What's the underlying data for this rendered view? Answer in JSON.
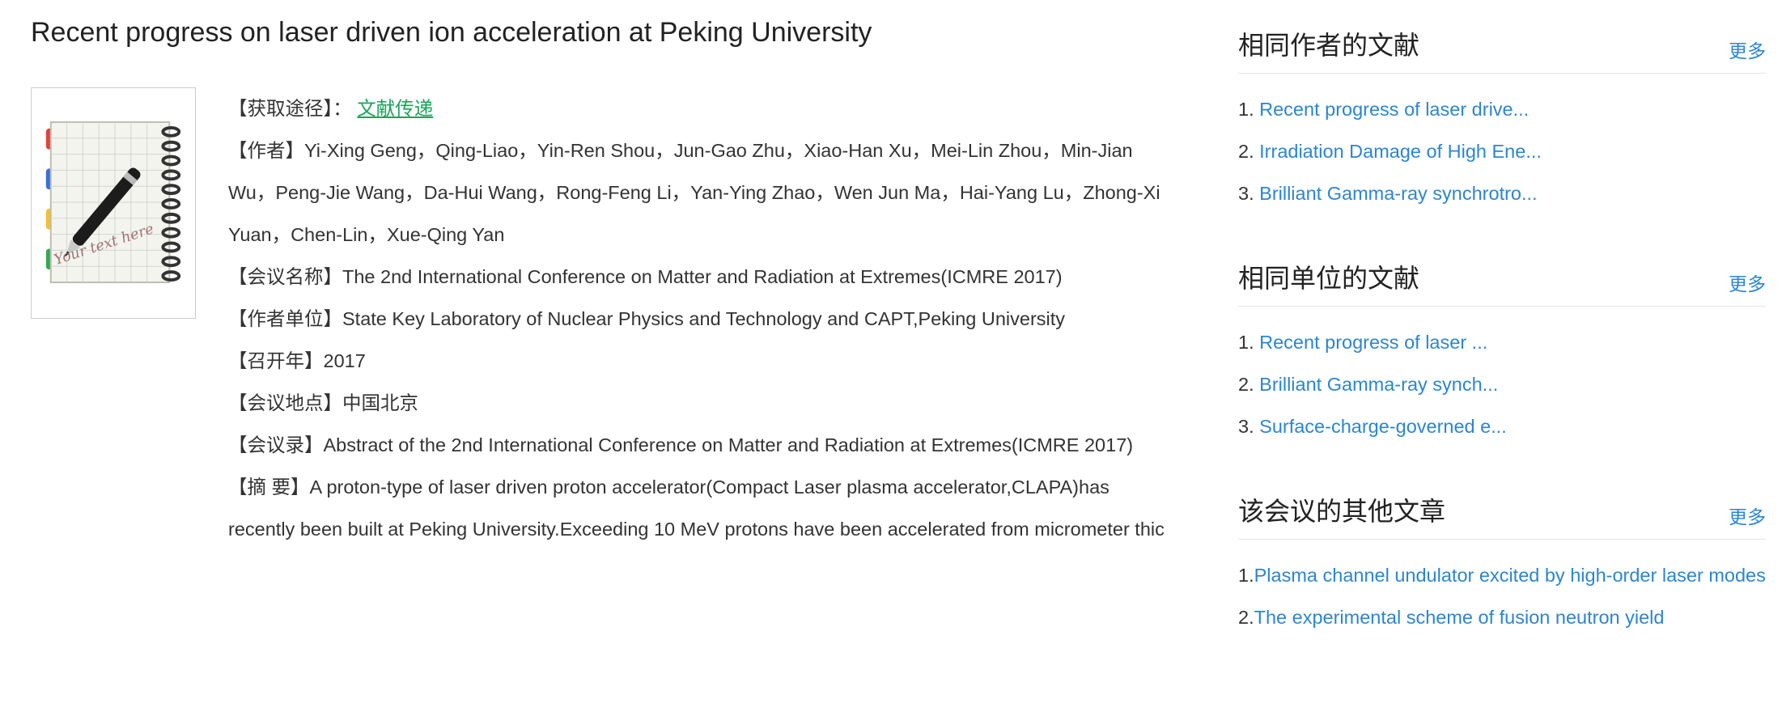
{
  "title": "Recent progress on laser driven ion acceleration at Peking University",
  "meta": {
    "access_label": "【获取途径】：",
    "access_link": "文献传递",
    "authors_label": "【作者】",
    "authors": "Yi-Xing Geng，Qing-Liao，Yin-Ren Shou，Jun-Gao Zhu，Xiao-Han Xu，Mei-Lin Zhou，Min-Jian Wu，Peng-Jie Wang，Da-Hui Wang，Rong-Feng Li，Yan-Ying Zhao，Wen Jun Ma，Hai-Yang Lu，Zhong-Xi Yuan，Chen-Lin，Xue-Qing Yan",
    "conference_label": "【会议名称】",
    "conference": "The 2nd International Conference on Matter and Radiation at Extremes(ICMRE 2017)",
    "affiliation_label": "【作者单位】",
    "affiliation": "State Key Laboratory of Nuclear Physics and Technology and CAPT,Peking University",
    "year_label": "【召开年】",
    "year": "2017",
    "location_label": "【会议地点】",
    "location": "中国北京",
    "proceedings_label": "【会议录】",
    "proceedings": "Abstract of the 2nd International Conference on Matter and Radiation at Extremes(ICMRE 2017)",
    "abstract_label": "【摘 要】",
    "abstract": "A proton-type of laser driven proton accelerator(Compact Laser plasma accelerator,CLAPA)has recently been built at Peking University.Exceeding 10 MeV protons have been accelerated from micrometer thic"
  },
  "thumbnail": {
    "caption": "Your text here"
  },
  "sidebar": {
    "more_label": "更多",
    "same_author": {
      "title": "相同作者的文献",
      "items": [
        {
          "num": "1.",
          "text": "Recent progress of laser drive..."
        },
        {
          "num": "2.",
          "text": "Irradiation Damage of High Ene..."
        },
        {
          "num": "3.",
          "text": "Brilliant Gamma-ray synchrotro..."
        }
      ]
    },
    "same_unit": {
      "title": "相同单位的文献",
      "items": [
        {
          "num": "1.",
          "text": "Recent progress of laser ..."
        },
        {
          "num": "2.",
          "text": "Brilliant Gamma-ray synch..."
        },
        {
          "num": "3.",
          "text": "Surface-charge-governed e..."
        }
      ]
    },
    "conference_other": {
      "title": "该会议的其他文章",
      "items": [
        {
          "num": "1.",
          "text": "Plasma channel undulator excited by high-order laser modes"
        },
        {
          "num": "2.",
          "text": "The experimental scheme of fusion neutron yield"
        }
      ]
    }
  },
  "colors": {
    "link": "#2b86d1",
    "green_link": "#1aa35a"
  }
}
